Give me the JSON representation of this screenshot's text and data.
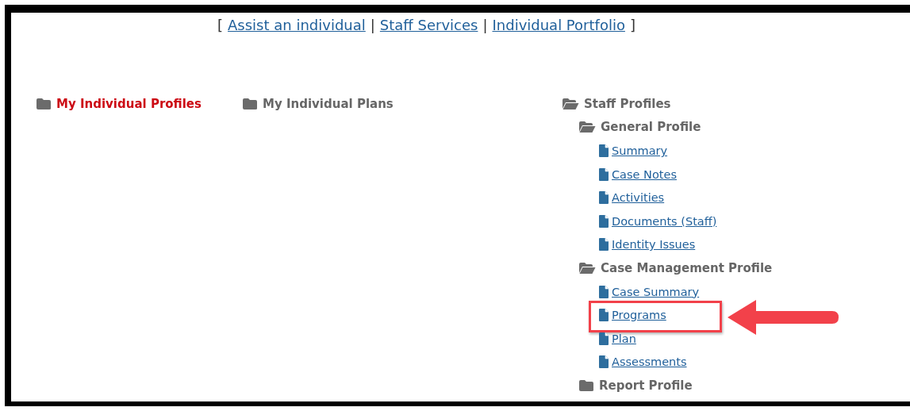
{
  "nav": {
    "open": "[",
    "separator": "|",
    "close": "]",
    "links": [
      "Assist an individual",
      "Staff Services",
      "Individual Portfolio"
    ]
  },
  "sections": [
    {
      "label": "My Individual Profiles",
      "selected": true
    },
    {
      "label": "My Individual Plans",
      "selected": false
    }
  ],
  "tree": [
    {
      "label": "Staff Profiles",
      "kind": "folder",
      "expanded": true,
      "children": [
        {
          "label": "General Profile",
          "kind": "folder",
          "expanded": true,
          "children": [
            {
              "label": "Summary",
              "kind": "link",
              "annotated": false
            },
            {
              "label": "Case Notes",
              "kind": "link",
              "annotated": false
            },
            {
              "label": "Activities",
              "kind": "link",
              "annotated": false
            },
            {
              "label": "Documents (Staff)",
              "kind": "link",
              "annotated": false
            },
            {
              "label": "Identity Issues",
              "kind": "link",
              "annotated": false
            }
          ]
        },
        {
          "label": "Case Management Profile",
          "kind": "folder",
          "expanded": true,
          "children": [
            {
              "label": "Case Summary",
              "kind": "link",
              "annotated": false
            },
            {
              "label": "Programs",
              "kind": "link",
              "annotated": true
            },
            {
              "label": "Plan",
              "kind": "link",
              "annotated": false
            },
            {
              "label": "Assessments",
              "kind": "link",
              "annotated": false
            }
          ]
        },
        {
          "label": "Report Profile",
          "kind": "folder",
          "expanded": false
        }
      ]
    }
  ]
}
